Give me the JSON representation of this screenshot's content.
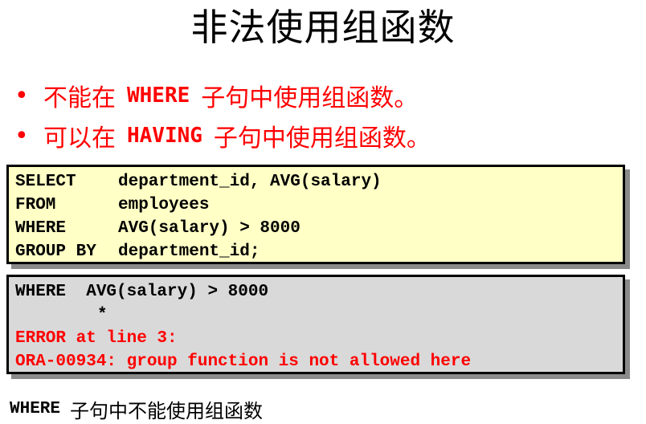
{
  "title": "非法使用组函数",
  "bullets": [
    {
      "symbol": "•",
      "prefix": "不能在",
      "keyword": "WHERE",
      "suffix": "子句中使用组函数。"
    },
    {
      "symbol": "•",
      "prefix": "可以在",
      "keyword": "HAVING",
      "suffix": "子句中使用组函数。"
    }
  ],
  "query_box": {
    "lines": [
      {
        "keyword": "SELECT",
        "rest": "department_id, AVG(salary)"
      },
      {
        "keyword": "FROM",
        "rest": "employees"
      },
      {
        "keyword": "WHERE",
        "rest": "AVG(salary) > 8000"
      },
      {
        "keyword": "GROUP BY",
        "rest": "department_id;"
      }
    ],
    "background": "#ffffc6"
  },
  "error_box": {
    "where_line": "WHERE  AVG(salary) > 8000",
    "marker": "*",
    "error_line_1": "ERROR at line 3:",
    "error_line_2": "ORA-00934: group function is not allowed here",
    "background": "#d9d9d9",
    "error_color": "#ff0000"
  },
  "footer": {
    "keyword": "WHERE",
    "text": "子句中不能使用组函数"
  }
}
